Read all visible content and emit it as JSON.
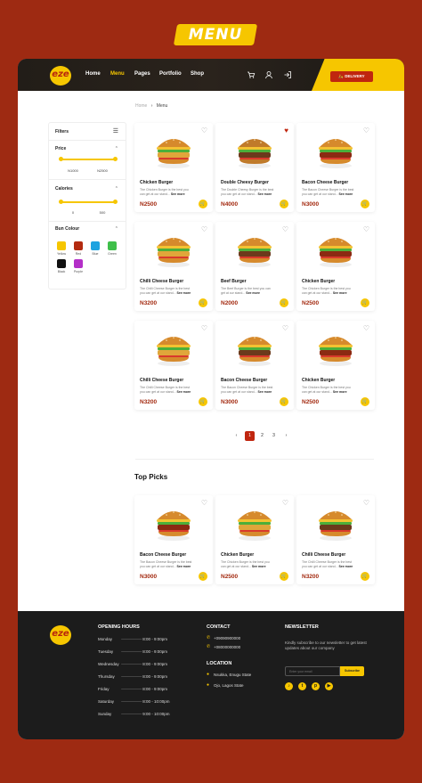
{
  "banner": {
    "title": "MENU"
  },
  "header": {
    "logo_text": "eze",
    "nav": [
      "Home",
      "Menu",
      "Pages",
      "Portfolio",
      "Shop"
    ],
    "active_nav": "Menu",
    "delivery_label": "DELIVERY"
  },
  "breadcrumb": {
    "home": "Home",
    "current": "Menu"
  },
  "filters": {
    "title": "Filters",
    "price": {
      "label": "Price",
      "min": "N1000",
      "max": "N2500"
    },
    "calories": {
      "label": "Calories",
      "min": "0",
      "max": "500"
    },
    "bun_colour": {
      "label": "Bun Colour",
      "colors": [
        {
          "name": "Yellow",
          "hex": "#f6c600"
        },
        {
          "name": "Red",
          "hex": "#b32b10"
        },
        {
          "name": "Blue",
          "hex": "#1fa3e0"
        },
        {
          "name": "Green",
          "hex": "#3fbf4a"
        },
        {
          "name": "Black",
          "hex": "#111111"
        },
        {
          "name": "Purple",
          "hex": "#b42fc8"
        }
      ]
    }
  },
  "menu_items": [
    {
      "name": "Chicken Burger",
      "desc": "The Chicken Burger is the best you can get at our stand...",
      "more": "See more",
      "price": "N2500",
      "liked": false
    },
    {
      "name": "Double Cheesy Burger",
      "desc": "The Double Cheesy Burger is the best you can get at our stand...",
      "more": "See more",
      "price": "N4000",
      "liked": true
    },
    {
      "name": "Bacon Cheese Burger",
      "desc": "The Bacon Cheese Burger is the best you can get at our stand...",
      "more": "See more",
      "price": "N3000",
      "liked": false
    },
    {
      "name": "Chilli Cheese Burger",
      "desc": "The Chilli Cheese Burger is the best you can get at our stand...",
      "more": "See more",
      "price": "N3200",
      "liked": false
    },
    {
      "name": "Beef Burger",
      "desc": "The Beef Burger is the best you can get at our stand...",
      "more": "See more",
      "price": "N2000",
      "liked": false
    },
    {
      "name": "Chicken Burger",
      "desc": "The Chicken Burger is the best you can get at our stand...",
      "more": "See more",
      "price": "N2500",
      "liked": false
    },
    {
      "name": "Chilli Cheese Burger",
      "desc": "The Chilli Cheese Burger is the best you can get at our stand...",
      "more": "See more",
      "price": "N3200",
      "liked": false
    },
    {
      "name": "Bacon Cheese Burger",
      "desc": "The Bacon Cheese Burger is the best you can get at our stand...",
      "more": "See more",
      "price": "N3000",
      "liked": false
    },
    {
      "name": "Chicken Burger",
      "desc": "The Chicken Burger is the best you can get at our stand...",
      "more": "See more",
      "price": "N2500",
      "liked": false
    }
  ],
  "pagination": {
    "prev": "‹",
    "pages": [
      "1",
      "2",
      "3"
    ],
    "active": "1",
    "next": "›"
  },
  "top_picks": {
    "title": "Top Picks",
    "items": [
      {
        "name": "Bacon Cheese Burger",
        "desc": "The Bacon Cheese Burger is the best you can get at our stand...",
        "more": "See more",
        "price": "N3000"
      },
      {
        "name": "Chicken Burger",
        "desc": "The Chicken Burger is the best you can get at our stand...",
        "more": "See more",
        "price": "N2500"
      },
      {
        "name": "Chilli Cheese Burger",
        "desc": "The Chilli Cheese Burger is the best you can get at our stand...",
        "more": "See more",
        "price": "N3200"
      }
    ]
  },
  "footer": {
    "logo_text": "eze",
    "opening_hours": {
      "title": "OPENING HOURS",
      "rows": [
        {
          "day": "Monday",
          "time": "8:00 - 9:00pm"
        },
        {
          "day": "Tuesday",
          "time": "8:00 - 9:00pm"
        },
        {
          "day": "Wednesday",
          "time": "8:00 - 9:00pm"
        },
        {
          "day": "Thursday",
          "time": "8:00 - 9:00pm"
        },
        {
          "day": "Friday",
          "time": "8:00 - 9:00pm"
        },
        {
          "day": "Saturday",
          "time": "8:00 - 10:00pm"
        },
        {
          "day": "Sunday",
          "time": "9:00 - 10:00pm"
        }
      ]
    },
    "contact": {
      "title": "CONTACT",
      "phones": [
        "+09090900000",
        "+08000000000"
      ]
    },
    "location": {
      "title": "LOCATION",
      "places": [
        "Nsukka, Enugu State",
        "Ojo, Lagos State"
      ]
    },
    "newsletter": {
      "title": "NEWSLETTER",
      "text": "Kindly subscribe to our newsletter to get latest updates about our company",
      "placeholder": "Enter your email",
      "button": "Subscribe"
    }
  },
  "colors": {
    "brand_red": "#c0260f",
    "brand_yellow": "#f6c600",
    "background": "#9e2a12"
  }
}
